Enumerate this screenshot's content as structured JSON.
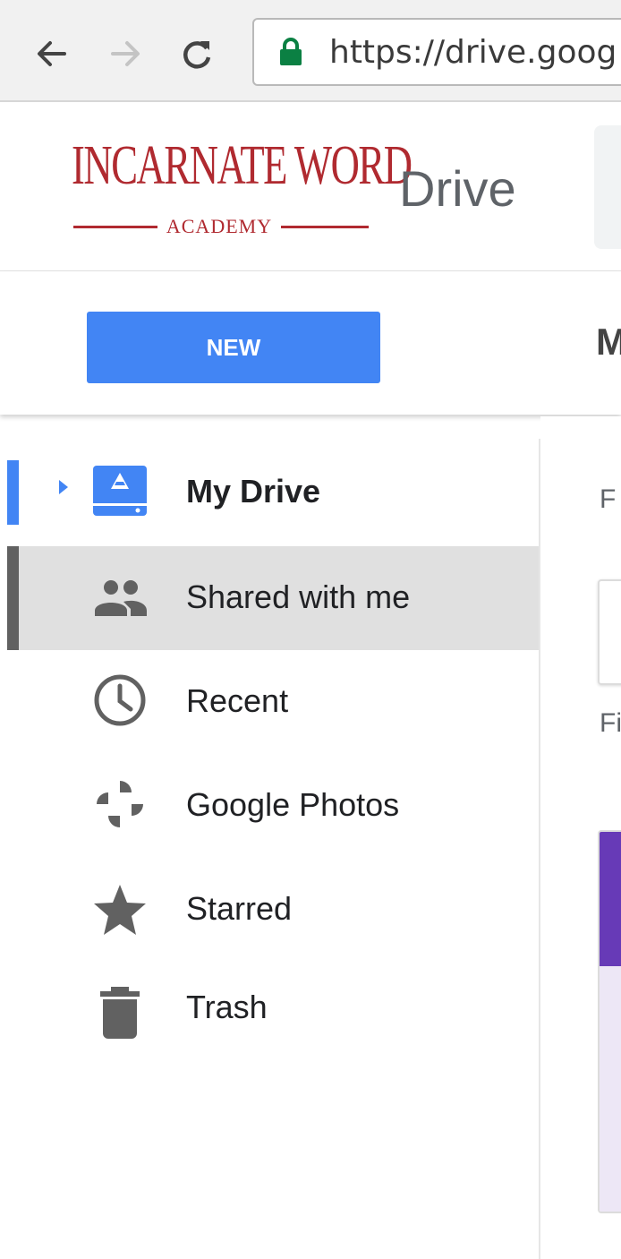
{
  "browser": {
    "url": "https://drive.goog",
    "lock_color": "#0b8043"
  },
  "header": {
    "logo_main": "INCARNATE WORD",
    "logo_sub": "ACADEMY",
    "app_name": "Drive"
  },
  "toolbar": {
    "new_label": "NEW",
    "page_heading": "M",
    "new_color": "#4285f4"
  },
  "sidebar": {
    "items": [
      {
        "label": "My Drive",
        "icon": "my-drive-icon",
        "selected": true
      },
      {
        "label": "Shared with me",
        "icon": "shared-people-icon",
        "highlighted": true
      },
      {
        "label": "Recent",
        "icon": "clock-icon"
      },
      {
        "label": "Google Photos",
        "icon": "pinwheel-icon"
      },
      {
        "label": "Starred",
        "icon": "star-icon"
      },
      {
        "label": "Trash",
        "icon": "trash-icon"
      }
    ],
    "accent": "#4285f4"
  },
  "main": {
    "folders_label": "F",
    "files_label": "Fi",
    "file_card_color": "#673ab7"
  }
}
